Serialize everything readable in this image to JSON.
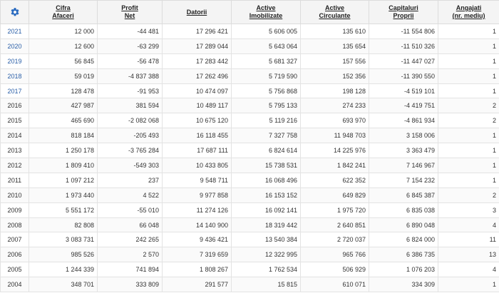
{
  "colors": {
    "gear": "#2a6bc0",
    "link": "#2a5fa8"
  },
  "header": {
    "settings_icon": "gear-icon",
    "columns": [
      {
        "line1": "Cifra",
        "line2": "Afaceri"
      },
      {
        "line1": "Profit",
        "line2": "Net"
      },
      {
        "line1": "Datorii",
        "line2": ""
      },
      {
        "line1": "Active",
        "line2": "Imobilizate"
      },
      {
        "line1": "Active",
        "line2": "Circulante"
      },
      {
        "line1": "Capitaluri",
        "line2": "Proprii"
      },
      {
        "line1": "Angajati",
        "line2": "(nr. mediu)"
      }
    ]
  },
  "rows": [
    {
      "year": "2021",
      "link": true,
      "values": [
        "12 000",
        "-44 481",
        "17 296 421",
        "5 606 005",
        "135 610",
        "-11 554 806",
        "1"
      ]
    },
    {
      "year": "2020",
      "link": true,
      "values": [
        "12 600",
        "-63 299",
        "17 289 044",
        "5 643 064",
        "135 654",
        "-11 510 326",
        "1"
      ]
    },
    {
      "year": "2019",
      "link": true,
      "values": [
        "56 845",
        "-56 478",
        "17 283 442",
        "5 681 327",
        "157 556",
        "-11 447 027",
        "1"
      ]
    },
    {
      "year": "2018",
      "link": true,
      "values": [
        "59 019",
        "-4 837 388",
        "17 262 496",
        "5 719 590",
        "152 356",
        "-11 390 550",
        "1"
      ]
    },
    {
      "year": "2017",
      "link": true,
      "values": [
        "128 478",
        "-91 953",
        "10 474 097",
        "5 756 868",
        "198 128",
        "-4 519 101",
        "1"
      ]
    },
    {
      "year": "2016",
      "link": false,
      "values": [
        "427 987",
        "381 594",
        "10 489 117",
        "5 795 133",
        "274 233",
        "-4 419 751",
        "2"
      ]
    },
    {
      "year": "2015",
      "link": false,
      "values": [
        "465 690",
        "-2 082 068",
        "10 675 120",
        "5 119 216",
        "693 970",
        "-4 861 934",
        "2"
      ]
    },
    {
      "year": "2014",
      "link": false,
      "values": [
        "818 184",
        "-205 493",
        "16 118 455",
        "7 327 758",
        "11 948 703",
        "3 158 006",
        "1"
      ]
    },
    {
      "year": "2013",
      "link": false,
      "values": [
        "1 250 178",
        "-3 765 284",
        "17 687 111",
        "6 824 614",
        "14 225 976",
        "3 363 479",
        "1"
      ]
    },
    {
      "year": "2012",
      "link": false,
      "values": [
        "1 809 410",
        "-549 303",
        "10 433 805",
        "15 738 531",
        "1 842 241",
        "7 146 967",
        "1"
      ]
    },
    {
      "year": "2011",
      "link": false,
      "values": [
        "1 097 212",
        "237",
        "9 548 711",
        "16 068 496",
        "622 352",
        "7 154 232",
        "1"
      ]
    },
    {
      "year": "2010",
      "link": false,
      "values": [
        "1 973 440",
        "4 522",
        "9 977 858",
        "16 153 152",
        "649 829",
        "6 845 387",
        "2"
      ]
    },
    {
      "year": "2009",
      "link": false,
      "values": [
        "5 551 172",
        "-55 010",
        "11 274 126",
        "16 092 141",
        "1 975 720",
        "6 835 038",
        "3"
      ]
    },
    {
      "year": "2008",
      "link": false,
      "values": [
        "82 808",
        "66 048",
        "14 140 900",
        "18 319 442",
        "2 640 851",
        "6 890 048",
        "4"
      ]
    },
    {
      "year": "2007",
      "link": false,
      "values": [
        "3 083 731",
        "242 265",
        "9 436 421",
        "13 540 384",
        "2 720 037",
        "6 824 000",
        "11"
      ]
    },
    {
      "year": "2006",
      "link": false,
      "values": [
        "985 526",
        "2 570",
        "7 319 659",
        "12 322 995",
        "965 766",
        "6 386 735",
        "13"
      ]
    },
    {
      "year": "2005",
      "link": false,
      "values": [
        "1 244 339",
        "741 894",
        "1 808 267",
        "1 762 534",
        "506 929",
        "1 076 203",
        "4"
      ]
    },
    {
      "year": "2004",
      "link": false,
      "values": [
        "348 701",
        "333 809",
        "291 577",
        "15 815",
        "610 071",
        "334 309",
        "1"
      ]
    }
  ]
}
